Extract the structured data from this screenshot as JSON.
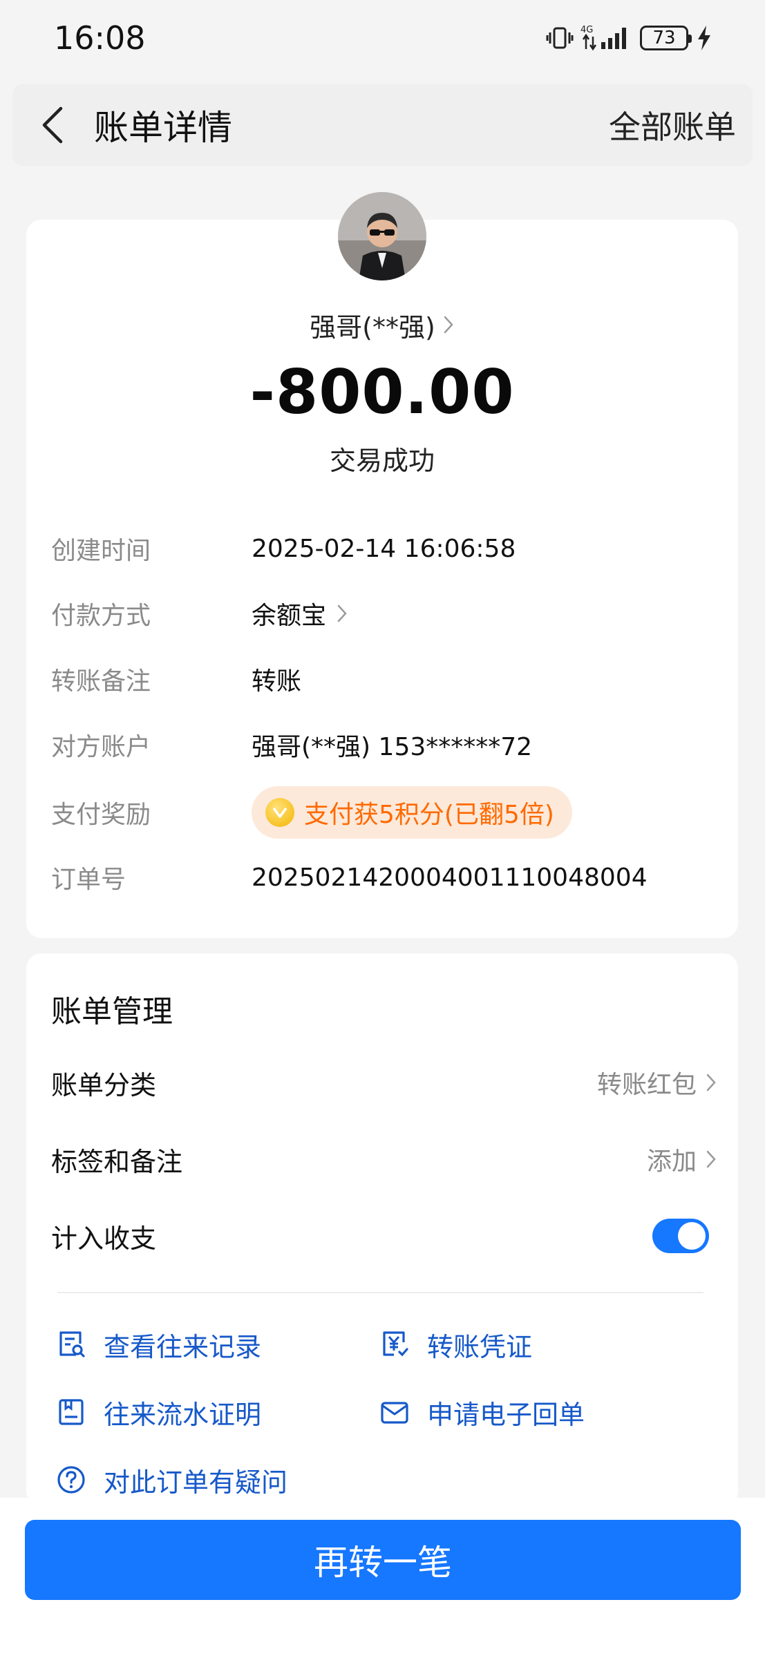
{
  "status_bar": {
    "time": "16:08",
    "network": "4G",
    "battery": "73"
  },
  "header": {
    "title": "账单详情",
    "all_bills": "全部账单"
  },
  "transaction": {
    "payee": "强哥(**强)",
    "amount": "-800.00",
    "status": "交易成功"
  },
  "details": {
    "created_label": "创建时间",
    "created_value": "2025-02-14 16:06:58",
    "payment_label": "付款方式",
    "payment_value": "余额宝",
    "note_label": "转账备注",
    "note_value": "转账",
    "counterparty_label": "对方账户",
    "counterparty_value": "强哥(**强) 153******72",
    "reward_label": "支付奖励",
    "reward_value": "支付获5积分(已翻5倍)",
    "order_label": "订单号",
    "order_value": "2025021420004001110048004"
  },
  "manage": {
    "title": "账单管理",
    "category_label": "账单分类",
    "category_value": "转账红包",
    "tags_label": "标签和备注",
    "tags_value": "添加",
    "include_label": "计入收支",
    "include_on": true,
    "actions": {
      "history": "查看往来记录",
      "voucher": "转账凭证",
      "statement": "往来流水证明",
      "receipt": "申请电子回单",
      "question": "对此订单有疑问"
    }
  },
  "bottom": {
    "button": "再转一笔"
  },
  "colors": {
    "accent": "#1677ff",
    "link": "#1659c9",
    "reward": "#ff6a00"
  }
}
